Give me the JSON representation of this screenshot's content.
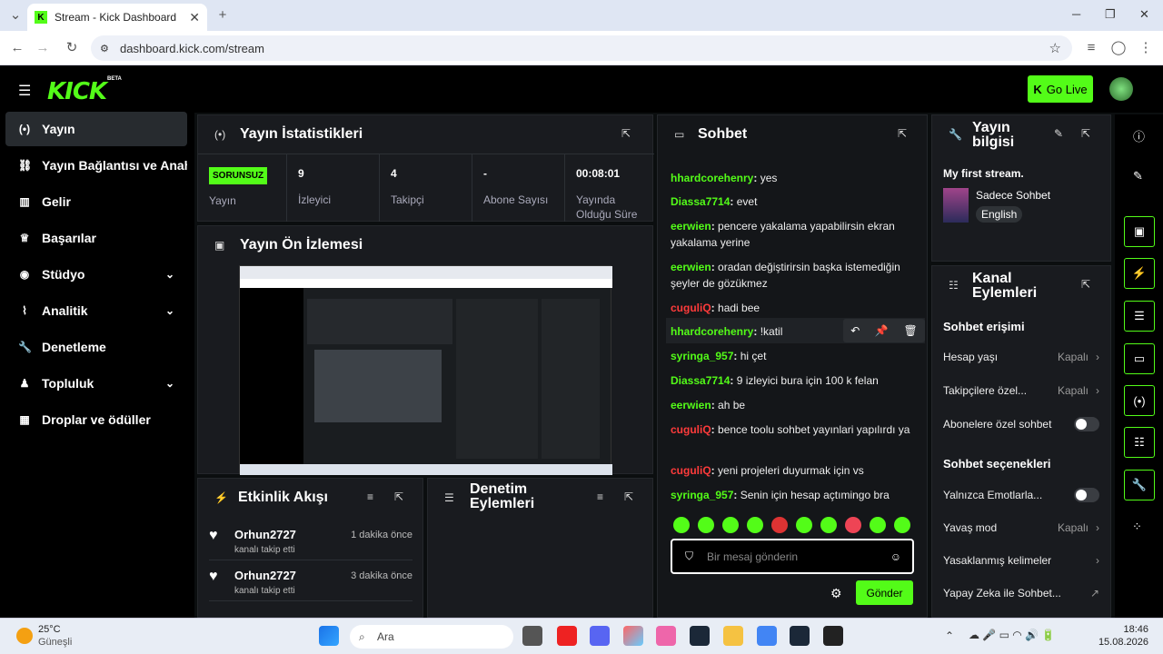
{
  "browser": {
    "tab_title": "Stream - Kick Dashboard",
    "url": "dashboard.kick.com/stream"
  },
  "app": {
    "logo": "KICK",
    "beta": "BETA",
    "go_live": "Go Live"
  },
  "sidebar": {
    "items": [
      {
        "label": "Yayın",
        "icon": "broadcast-icon"
      },
      {
        "label": "Yayın Bağlantısı ve Anahtar",
        "icon": "link-icon"
      },
      {
        "label": "Gelir",
        "icon": "revenue-icon"
      },
      {
        "label": "Başarılar",
        "icon": "trophy-icon"
      },
      {
        "label": "Stüdyo",
        "icon": "studio-icon"
      },
      {
        "label": "Analitik",
        "icon": "analytics-icon"
      },
      {
        "label": "Denetleme",
        "icon": "wrench-icon"
      },
      {
        "label": "Topluluk",
        "icon": "community-icon"
      },
      {
        "label": "Droplar ve ödüller",
        "icon": "gift-icon"
      }
    ]
  },
  "stats": {
    "title": "Yayın İstatistikleri",
    "status_badge": "SORUNSUZ",
    "status_label": "Yayın",
    "items": [
      {
        "value": "9",
        "label": "İzleyici"
      },
      {
        "value": "4",
        "label": "Takipçi"
      },
      {
        "value": "-",
        "label": "Abone Sayısı"
      },
      {
        "value": "00:08:01",
        "label": "Yayında Olduğu Süre"
      }
    ]
  },
  "preview": {
    "title": "Yayın Ön İzlemesi"
  },
  "activity": {
    "title": "Etkinlik Akışı",
    "items": [
      {
        "user": "Orhun2727",
        "time": "1 dakika önce",
        "text": "kanalı takip etti"
      },
      {
        "user": "Orhun2727",
        "time": "3 dakika önce",
        "text": "kanalı takip etti"
      }
    ]
  },
  "moderation": {
    "title": "Denetim Eylemleri"
  },
  "chat": {
    "title": "Sohbet",
    "placeholder": "Bir mesaj gönderin",
    "send": "Gönder",
    "messages": [
      {
        "user": "hhardcorehenry",
        "text": "yes",
        "color": "#53fc18"
      },
      {
        "user": "Diassa7714",
        "text": "evet",
        "color": "#53fc18"
      },
      {
        "user": "eerwien",
        "text": "pencere yakalama yapabilirsin ekran yakalama yerine",
        "color": "#53fc18"
      },
      {
        "user": "eerwien",
        "text": "oradan değiştirirsin başka istemediğin şeyler de gözükmez",
        "color": "#53fc18"
      },
      {
        "user": "cuguliQ",
        "text": "hadi bee",
        "color": "#ff3b3b"
      },
      {
        "user": "hhardcorehenry",
        "text": "!katil",
        "color": "#53fc18"
      },
      {
        "user": "syringa_957",
        "text": "hi çet",
        "color": "#53fc18"
      },
      {
        "user": "Diassa7714",
        "text": "9 izleyici bura için 100 k felan",
        "color": "#53fc18"
      },
      {
        "user": "eerwien",
        "text": "ah be",
        "color": "#53fc18"
      },
      {
        "user": "cuguliQ",
        "text": "bence toolu sohbet yayınlari yapılırdı ya",
        "color": "#ff3b3b"
      },
      {
        "user": "cuguliQ",
        "text": "yeni projeleri duyurmak için vs",
        "color": "#ff3b3b"
      },
      {
        "user": "syringa_957",
        "text": "Senin için hesap açtımingo bra",
        "color": "#53fc18"
      }
    ]
  },
  "info": {
    "title": "Yayın bilgisi",
    "stream_title": "My first stream.",
    "category": "Sadece Sohbet",
    "language": "English"
  },
  "channel": {
    "title": "Kanal Eylemleri",
    "chat_access": "Sohbet erişimi",
    "chat_options": "Sohbet seçenekleri",
    "rows": [
      {
        "label": "Hesap yaşı",
        "value": "Kapalı"
      },
      {
        "label": "Takipçilere özel...",
        "value": "Kapalı"
      },
      {
        "label": "Abonelere özel sohbet",
        "value": ""
      },
      {
        "label": "Yalnızca Emotlarla...",
        "value": ""
      },
      {
        "label": "Yavaş mod",
        "value": "Kapalı"
      },
      {
        "label": "Yasaklanmış kelimeler",
        "value": ""
      },
      {
        "label": "Yapay Zeka ile Sohbet...",
        "value": ""
      }
    ]
  },
  "taskbar": {
    "temp": "25°C",
    "weather": "Güneşli",
    "search": "Ara",
    "time": "18:46",
    "date": "15.08.2026"
  },
  "colors": {
    "accent": "#53fc18",
    "panel": "#191b1f"
  }
}
